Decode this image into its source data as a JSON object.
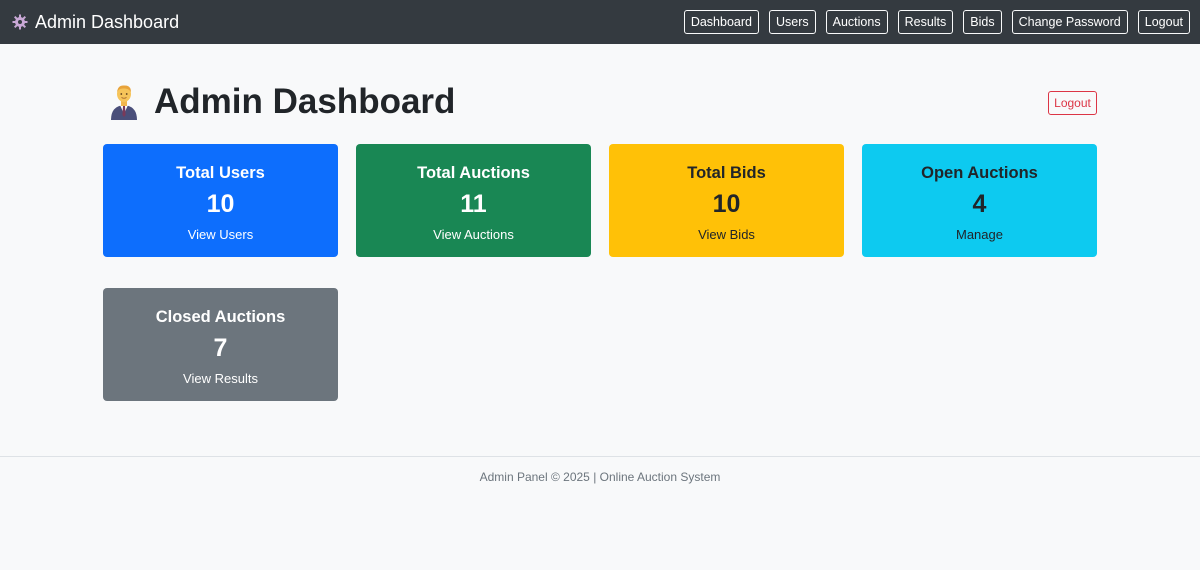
{
  "navbar": {
    "brand": "Admin Dashboard",
    "brand_icon": "gear-icon",
    "links": [
      "Dashboard",
      "Users",
      "Auctions",
      "Results",
      "Bids",
      "Change Password",
      "Logout"
    ]
  },
  "header": {
    "icon": "person-in-suit-icon",
    "title": "Admin Dashboard",
    "logout_label": "Logout"
  },
  "cards": [
    {
      "title": "Total Users",
      "value": "10",
      "link": "View Users",
      "bg": "#0d6efd",
      "fg": "#ffffff"
    },
    {
      "title": "Total Auctions",
      "value": "11",
      "link": "View Auctions",
      "bg": "#198754",
      "fg": "#ffffff"
    },
    {
      "title": "Total Bids",
      "value": "10",
      "link": "View Bids",
      "bg": "#ffc107",
      "fg": "#212529"
    },
    {
      "title": "Open Auctions",
      "value": "4",
      "link": "Manage",
      "bg": "#0dcaf0",
      "fg": "#212529"
    },
    {
      "title": "Closed Auctions",
      "value": "7",
      "link": "View Results",
      "bg": "#6c757d",
      "fg": "#ffffff"
    }
  ],
  "footer": {
    "text": "Admin Panel © 2025 | Online Auction System"
  }
}
